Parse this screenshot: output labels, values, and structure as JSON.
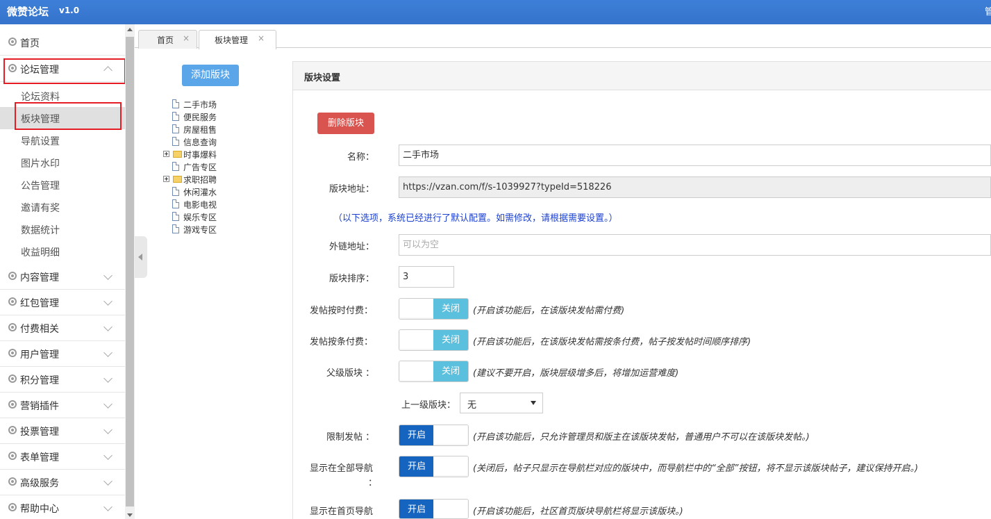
{
  "header": {
    "brand": "微赞论坛",
    "version": "v1.0",
    "edge_char": "管"
  },
  "sidebar": {
    "home": "首页",
    "forum_mgmt": "论坛管理",
    "sub_items": [
      "论坛资料",
      "板块管理",
      "导航设置",
      "图片水印",
      "公告管理",
      "邀请有奖",
      "数据统计",
      "收益明细"
    ],
    "groups": [
      "内容管理",
      "红包管理",
      "付费相关",
      "用户管理",
      "积分管理",
      "营销插件",
      "投票管理",
      "表单管理",
      "高级服务",
      "帮助中心"
    ]
  },
  "tabs": [
    {
      "label": "首页",
      "close": "×"
    },
    {
      "label": "板块管理",
      "close": "×"
    }
  ],
  "tree": {
    "add_button": "添加版块",
    "nodes": [
      "二手市场",
      "便民服务",
      "房屋租售",
      "信息查询",
      "时事爆料",
      "广告专区",
      "求职招聘",
      "休闲灌水",
      "电影电视",
      "娱乐专区",
      "游戏专区"
    ]
  },
  "panel": {
    "title": "版块设置",
    "delete_button": "删除版块",
    "name_label": "名称：",
    "name_value": "二手市场",
    "url_label": "版块地址：",
    "url_value": "https://vzan.com/f/s-1039927?typeId=518226",
    "notice": "（以下选项，系统已经进行了默认配置。如需修改，请根据需要设置。）",
    "ext_label": "外链地址：",
    "ext_placeholder": "可以为空",
    "order_label": "版块排序：",
    "order_value": "3",
    "timed_pay_label": "发帖按时付费：",
    "timed_pay_state": "关闭",
    "timed_pay_hint": "(开启该功能后，在该版块发帖需付费)",
    "item_pay_label": "发帖按条付费：",
    "item_pay_state": "关闭",
    "item_pay_hint": "(开启该功能后，在该版块发帖需按条付费，帖子按发帖时间顺序排序)",
    "parent_label": "父级版块 ：",
    "parent_state": "关闭",
    "parent_hint": "(建议不要开启，版块层级增多后，将增加运营难度)",
    "upper_label": "上一级版块：",
    "upper_value": "无",
    "restrict_label": "限制发帖 ：",
    "restrict_state": "开启",
    "restrict_hint": "(开启该功能后，只允许管理员和版主在该版块发帖，普通用户不可以在该版块发帖。)",
    "show_all_label": "显示在全部导航",
    "show_all_colon": "：",
    "show_all_state": "开启",
    "show_all_hint": "(关闭后，帖子只显示在导航栏对应的版块中，而导航栏中的“全部”按钮，将不显示该版块帖子，建议保持开启。)",
    "show_home_label": "显示在首页导航",
    "show_home_state": "开启",
    "show_home_hint": "(开启该功能后，社区首页版块导航栏将显示该版块。)"
  }
}
